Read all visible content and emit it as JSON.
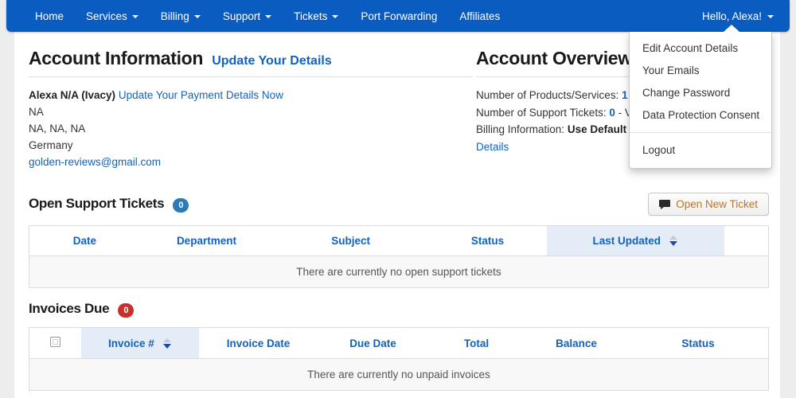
{
  "navbar": {
    "items": [
      {
        "label": "Home",
        "caret": false
      },
      {
        "label": "Services",
        "caret": true
      },
      {
        "label": "Billing",
        "caret": true
      },
      {
        "label": "Support",
        "caret": true
      },
      {
        "label": "Tickets",
        "caret": true
      },
      {
        "label": "Port Forwarding",
        "caret": false
      },
      {
        "label": "Affiliates",
        "caret": false
      }
    ],
    "account_label": "Hello, Alexa!",
    "brand_color": "#0b5cc0"
  },
  "account_menu": {
    "items": [
      "Edit Account Details",
      "Your Emails",
      "Change Password",
      "Data Protection Consent"
    ],
    "logout": "Logout"
  },
  "account_information": {
    "title": "Account Information",
    "update_link": "Update Your Details",
    "name": "Alexa N/A (Ivacy)",
    "payment_link": "Update Your Payment Details Now",
    "address_line1": "NA",
    "address_line2": "NA, NA, NA",
    "country": "Germany",
    "email": "golden-reviews@gmail.com"
  },
  "account_overview": {
    "title": "Account Overview",
    "products_label": "Number of Products/Services:",
    "products_value": "1",
    "products_trail": "(",
    "tickets_label": "Number of Support Tickets:",
    "tickets_value": "0",
    "tickets_trail": "- V",
    "billing_label": "Billing Information:",
    "billing_value": "Use Default (",
    "details_link": "Details"
  },
  "support_tickets": {
    "title": "Open Support Tickets",
    "count": "0",
    "button_label": "Open New Ticket",
    "button_icon": "comment-icon",
    "columns": [
      "Date",
      "Department",
      "Subject",
      "Status",
      "Last Updated",
      ""
    ],
    "sorted_column": "Last Updated",
    "sort_direction": "desc",
    "empty_message": "There are currently no open support tickets"
  },
  "invoices_due": {
    "title": "Invoices Due",
    "count": "0",
    "columns": [
      "",
      "Invoice #",
      "Invoice Date",
      "Due Date",
      "Total",
      "Balance",
      "Status"
    ],
    "sorted_column": "Invoice #",
    "sort_direction": "desc",
    "empty_message": "There are currently no unpaid invoices",
    "select_all_checked": false
  },
  "colors": {
    "link": "#1262bd",
    "badge_blue": "#2b7bb9",
    "badge_red": "#c9302c",
    "button_text": "#b8762a",
    "sorted_header_bg": "#e4edf7"
  }
}
